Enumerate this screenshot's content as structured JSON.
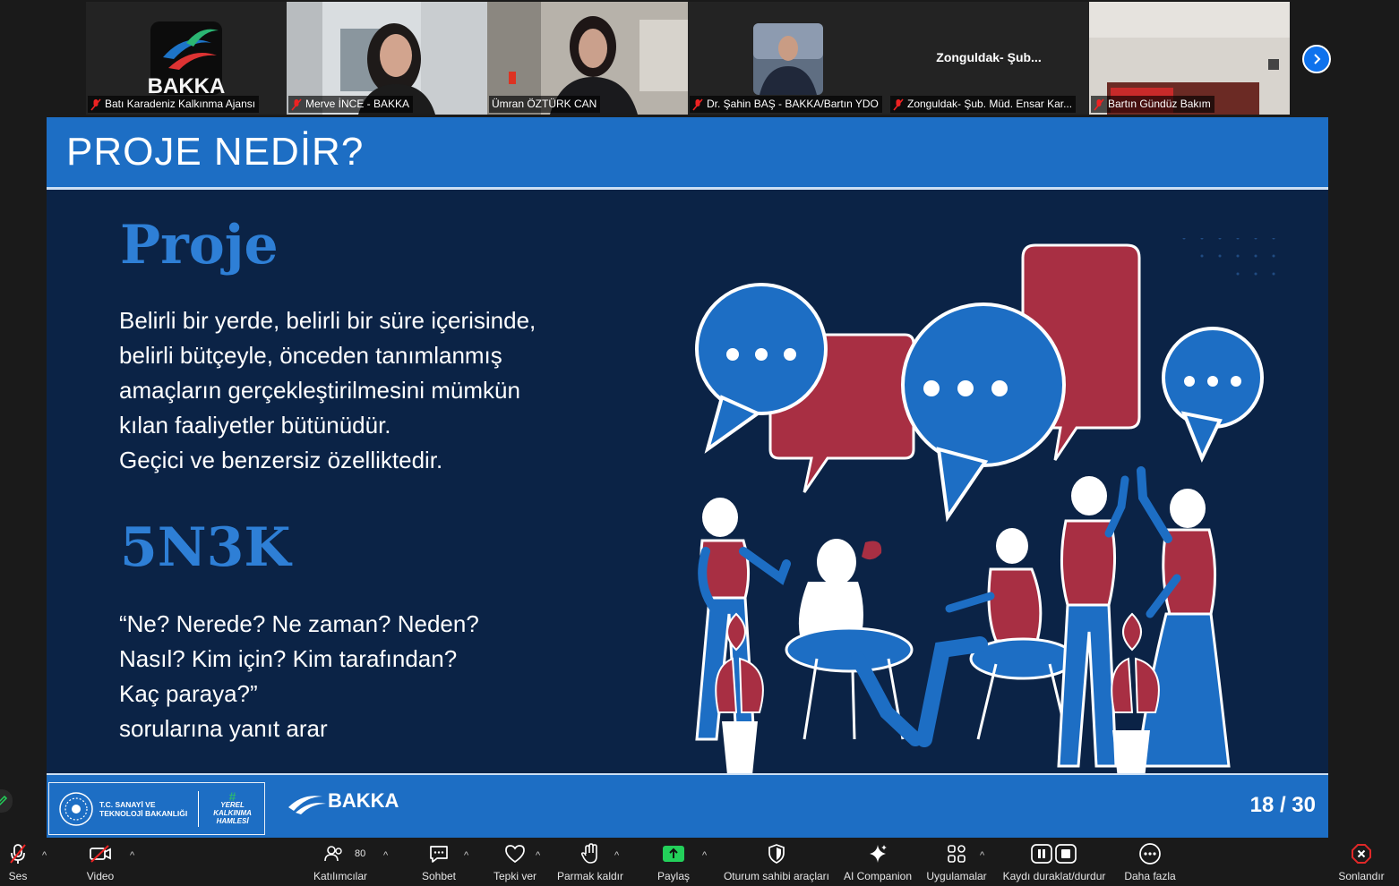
{
  "participants": [
    {
      "name": "Batı Karadeniz Kalkınma Ajansı",
      "logo_text": "BAKKA",
      "muted": true,
      "active": false
    },
    {
      "name": "Merve İNCE - BAKKA",
      "muted": true,
      "active": false
    },
    {
      "name": "Ümran ÖZTÜRK CAN",
      "muted": false,
      "active": true
    },
    {
      "name": "Dr. Şahin BAŞ - BAKKA/Bartın YDO",
      "muted": true,
      "active": false
    },
    {
      "name": "Zonguldak- Şub. Müd. Ensar Kar...",
      "center_name": "Zonguldak-  Şub...",
      "muted": true,
      "active": false
    },
    {
      "name": "Bartın Gündüz Bakım",
      "muted": true,
      "active": false
    }
  ],
  "slide": {
    "title": "PROJE NEDİR?",
    "heading1": "Proje",
    "paragraph1": [
      "Belirli bir yerde, belirli bir süre içerisinde,",
      "belirli bütçeyle, önceden tanımlanmış",
      "amaçların gerçekleştirilmesini mümkün",
      "kılan faaliyetler bütünüdür.",
      "Geçici ve benzersiz özelliktedir."
    ],
    "heading2": "5N3K",
    "paragraph2": [
      "“Ne? Nerede? Ne zaman? Neden?",
      "Nasıl? Kim için? Kim tarafından?",
      "Kaç paraya?”",
      "sorularına yanıt arar"
    ],
    "footer": {
      "ministry_line1": "T.C. SANAYİ VE",
      "ministry_line2": "TEKNOLOJİ BAKANLIĞI",
      "yerel_line1": "YEREL",
      "yerel_line2": "KALKINMA",
      "yerel_line3": "HAMLESİ",
      "bakka": "BAKKA",
      "page": "18 / 30"
    }
  },
  "toolbar": {
    "audio": "Ses",
    "video": "Video",
    "participants": "Katılımcılar",
    "participants_count": "80",
    "chat": "Sohbet",
    "react": "Tepki ver",
    "raise_hand": "Parmak kaldır",
    "share": "Paylaş",
    "host_tools": "Oturum sahibi araçları",
    "ai_companion": "AI Companion",
    "apps": "Uygulamalar",
    "record": "Kaydı duraklat/durdur",
    "more": "Daha fazla",
    "end": "Sonlandır"
  },
  "colors": {
    "slide_bg": "#0b2346",
    "slide_blue": "#1d6ec4",
    "accent_red": "#a82f43",
    "active_green": "#23d05a",
    "share_green": "#23d05a",
    "end_red": "#e02828"
  }
}
